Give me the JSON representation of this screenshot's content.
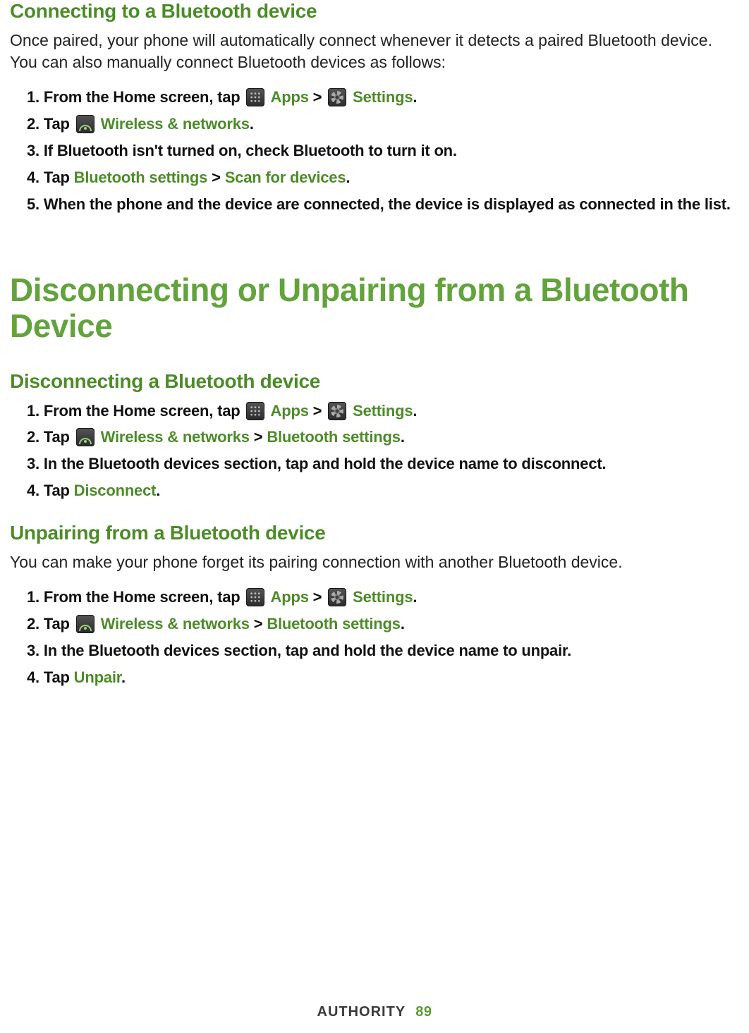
{
  "sec1": {
    "heading": "Connecting to a Bluetooth device",
    "intro": "Once paired, your phone will automatically connect whenever it detects a paired Bluetooth device. You can also manually connect Bluetooth devices as follows:",
    "step1_a": "From the Home screen, tap",
    "apps": "Apps",
    "gt": ">",
    "settings": "Settings",
    "step2_a": "Tap",
    "wireless": "Wireless & networks",
    "step3": "If Bluetooth isn't turned on, check Bluetooth to turn it on.",
    "step4_a": "Tap ",
    "btsettings": "Bluetooth settings",
    "scan": "Scan for devices",
    "step5": "When the phone and the device are connected, the device is displayed as connected in the list."
  },
  "sec2": {
    "main_heading": "Disconnecting or Unpairing from a Bluetooth Device",
    "sub_a": {
      "heading": "Disconnecting a Bluetooth device",
      "step1_a": "From the Home screen, tap",
      "apps": "Apps",
      "gt": ">",
      "settings": "Settings",
      "step2_a": "Tap",
      "wireless": "Wireless & networks",
      "btsettings": "Bluetooth settings",
      "step3": "In the Bluetooth devices section, tap and hold the device name to disconnect.",
      "step4_a": "Tap ",
      "disconnect": "Disconnect"
    },
    "sub_b": {
      "heading": "Unpairing from a Bluetooth device",
      "intro": "You can make your phone forget its pairing connection with another Bluetooth device.",
      "step1_a": "From the Home screen, tap",
      "apps": "Apps",
      "gt": ">",
      "settings": "Settings",
      "step2_a": "Tap",
      "wireless": "Wireless & networks",
      "btsettings": "Bluetooth settings",
      "step3": "In the Bluetooth devices section, tap and hold the device name to unpair.",
      "step4_a": "Tap ",
      "unpair": "Unpair"
    }
  },
  "footer": {
    "brand": "AUTHORITY",
    "page": "89"
  },
  "period": "."
}
